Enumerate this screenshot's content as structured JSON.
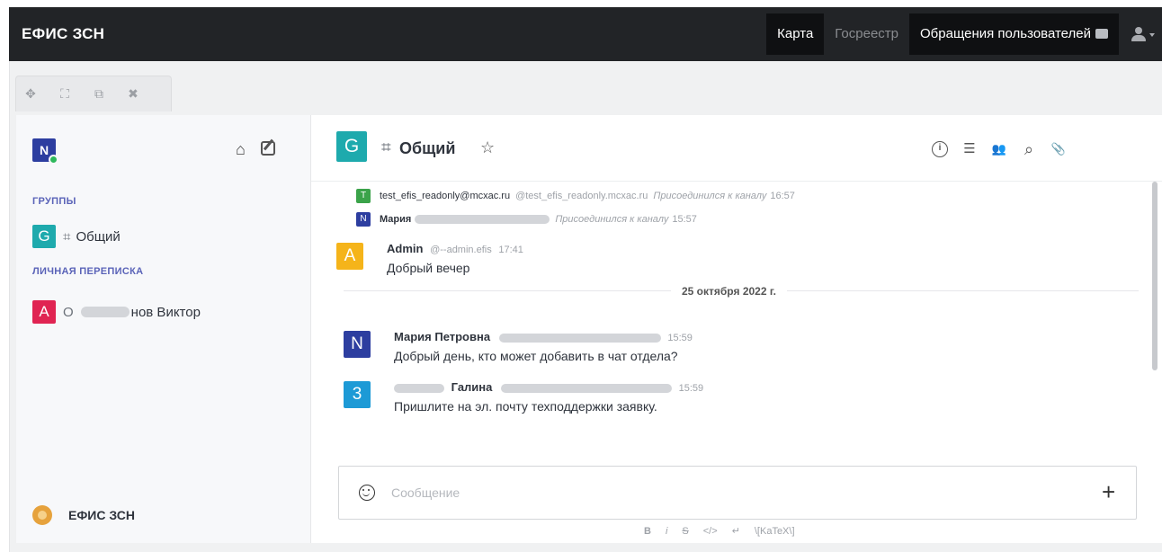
{
  "app": {
    "title": "ЕФИС ЗСН"
  },
  "topnav": {
    "items": [
      {
        "label": "Карта"
      },
      {
        "label": "Госреестр"
      },
      {
        "label": "Обращения пользователей"
      }
    ],
    "user_icon": "user-icon"
  },
  "window_controls": {
    "icons": [
      "move-icon",
      "expand-icon",
      "external-link-icon",
      "close-icon"
    ],
    "glyphs": [
      "✥",
      "⛶",
      "⧉",
      "✖"
    ]
  },
  "sidebar": {
    "avatar": "N",
    "sections": {
      "groups": "ГРУППЫ",
      "direct": "ЛИЧНАЯ ПЕРЕПИСКА"
    },
    "rooms": [
      {
        "avatar": "G",
        "hash": "⌗",
        "label": "Общий",
        "color": "#1eaaad"
      }
    ],
    "dms": [
      {
        "avatar": "A",
        "prefix": "О",
        "label": "нов Виктор",
        "color": "#e02452"
      }
    ],
    "footer": {
      "label": "ЕФИС ЗСН"
    }
  },
  "room": {
    "avatar": "G",
    "hash": "⌗",
    "title": "Общий",
    "star": "☆",
    "tool_glyphs": {
      "info": "i",
      "threads": "☰",
      "members": "👥",
      "search": "⌕",
      "files": "📎"
    }
  },
  "messages": {
    "system": [
      {
        "avatar": "T",
        "color": "#3ba34a",
        "user": "test_efis_readonly@mcxac.ru",
        "username": "@test_efis_readonly.mcxac.ru",
        "action": "Присоединился к каналу",
        "time": "16:57"
      },
      {
        "avatar": "N",
        "color": "#2d3ea0",
        "user": "Мария",
        "username": "",
        "action": "Присоединился к каналу",
        "time": "15:57"
      }
    ],
    "items": [
      {
        "avatar": "A",
        "color": "#f5b41a",
        "name": "Admin",
        "username": "@--admin.efis",
        "time": "17:41",
        "text": "Добрый вечер"
      },
      {
        "avatar": "N",
        "color": "#2d3ea0",
        "name": "Мария Петровна",
        "username": "",
        "time": "15:59",
        "text": "Добрый день, кто может добавить в чат отдела?"
      },
      {
        "avatar": "3",
        "color": "#1d9ad6",
        "name": "Галина",
        "username": "",
        "time": "15:59",
        "text": "Пришлите на эл. почту техподдержки заявку."
      }
    ],
    "date_divider": "25 октября 2022 г."
  },
  "composer": {
    "placeholder": "Сообщение",
    "plus": "+",
    "format": [
      "B",
      "i",
      "S",
      "</>",
      "↵",
      "\\[KaTeX\\]"
    ]
  }
}
